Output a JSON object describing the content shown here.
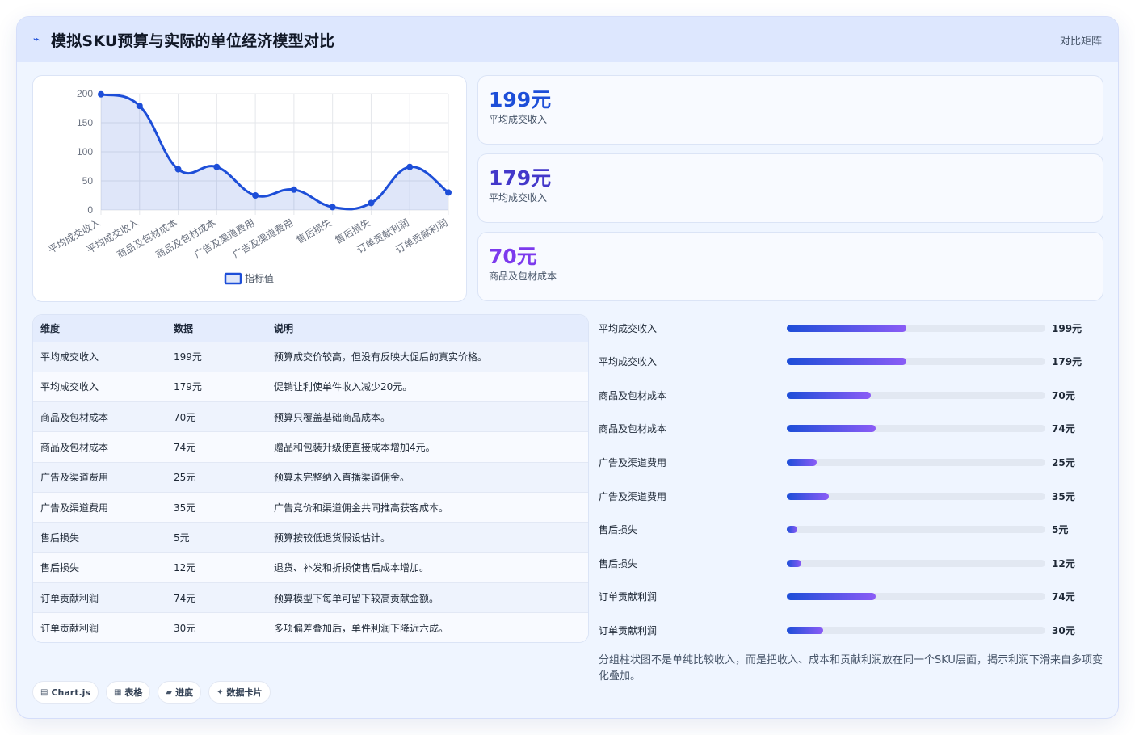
{
  "header": {
    "icon": "trend-icon",
    "title": "模拟SKU预算与实际的单位经济模型对比",
    "right_link": "对比矩阵"
  },
  "chart_data": {
    "type": "line",
    "fill": true,
    "smooth": true,
    "categories": [
      "平均成交收入",
      "平均成交收入",
      "商品及包材成本",
      "商品及包材成本",
      "广告及渠道费用",
      "广告及渠道费用",
      "售后损失",
      "售后损失",
      "订单贡献利润",
      "订单贡献利润"
    ],
    "series": [
      {
        "name": "指标值",
        "values": [
          199,
          179,
          70,
          74,
          25,
          35,
          5,
          12,
          74,
          30
        ]
      }
    ],
    "ylim": [
      0,
      200
    ],
    "yticks": [
      0,
      50,
      100,
      150,
      200
    ],
    "legend_position": "bottom",
    "grid": true,
    "color": "#1d4ed8"
  },
  "stats": [
    {
      "value": "199元",
      "label": "平均成交收入",
      "color": "#1d4ed8"
    },
    {
      "value": "179元",
      "label": "平均成交收入",
      "color": "#4338ca"
    },
    {
      "value": "70元",
      "label": "商品及包材成本",
      "color": "#7c3aed"
    }
  ],
  "table": {
    "headers": [
      "维度",
      "数据",
      "说明"
    ],
    "rows": [
      [
        "平均成交收入",
        "199元",
        "预算成交价较高，但没有反映大促后的真实价格。"
      ],
      [
        "平均成交收入",
        "179元",
        "促销让利使单件收入减少20元。"
      ],
      [
        "商品及包材成本",
        "70元",
        "预算只覆盖基础商品成本。"
      ],
      [
        "商品及包材成本",
        "74元",
        "赠品和包装升级使直接成本增加4元。"
      ],
      [
        "广告及渠道费用",
        "25元",
        "预算未完整纳入直播渠道佣金。"
      ],
      [
        "广告及渠道费用",
        "35元",
        "广告竞价和渠道佣金共同推高获客成本。"
      ],
      [
        "售后损失",
        "5元",
        "预算按较低退货假设估计。"
      ],
      [
        "售后损失",
        "12元",
        "退货、补发和折损使售后成本增加。"
      ],
      [
        "订单贡献利润",
        "74元",
        "预算模型下每单可留下较高贡献金额。"
      ],
      [
        "订单贡献利润",
        "30元",
        "多项偏差叠加后，单件利润下降近六成。"
      ]
    ]
  },
  "progress": {
    "max": 430,
    "items": [
      {
        "label": "平均成交收入",
        "value": 199,
        "text": "199元"
      },
      {
        "label": "平均成交收入",
        "value": 199,
        "text": "179元"
      },
      {
        "label": "商品及包材成本",
        "value": 140,
        "text": "70元"
      },
      {
        "label": "商品及包材成本",
        "value": 148,
        "text": "74元"
      },
      {
        "label": "广告及渠道费用",
        "value": 50,
        "text": "25元"
      },
      {
        "label": "广告及渠道费用",
        "value": 70,
        "text": "35元"
      },
      {
        "label": "售后损失",
        "value": 18,
        "text": "5元"
      },
      {
        "label": "售后损失",
        "value": 24,
        "text": "12元"
      },
      {
        "label": "订单贡献利润",
        "value": 148,
        "text": "74元"
      },
      {
        "label": "订单贡献利润",
        "value": 60,
        "text": "30元"
      }
    ]
  },
  "note": "分组柱状图不是单纯比较收入，而是把收入、成本和贡献利润放在同一个SKU层面，揭示利润下滑来自多项变化叠加。",
  "chips": [
    {
      "icon": "chart-icon",
      "glyph": "▤",
      "label": "Chart.js"
    },
    {
      "icon": "table-icon",
      "glyph": "▦",
      "label": "表格"
    },
    {
      "icon": "progress-icon",
      "glyph": "▰",
      "label": "进度"
    },
    {
      "icon": "card-icon",
      "glyph": "✦",
      "label": "数据卡片"
    }
  ]
}
